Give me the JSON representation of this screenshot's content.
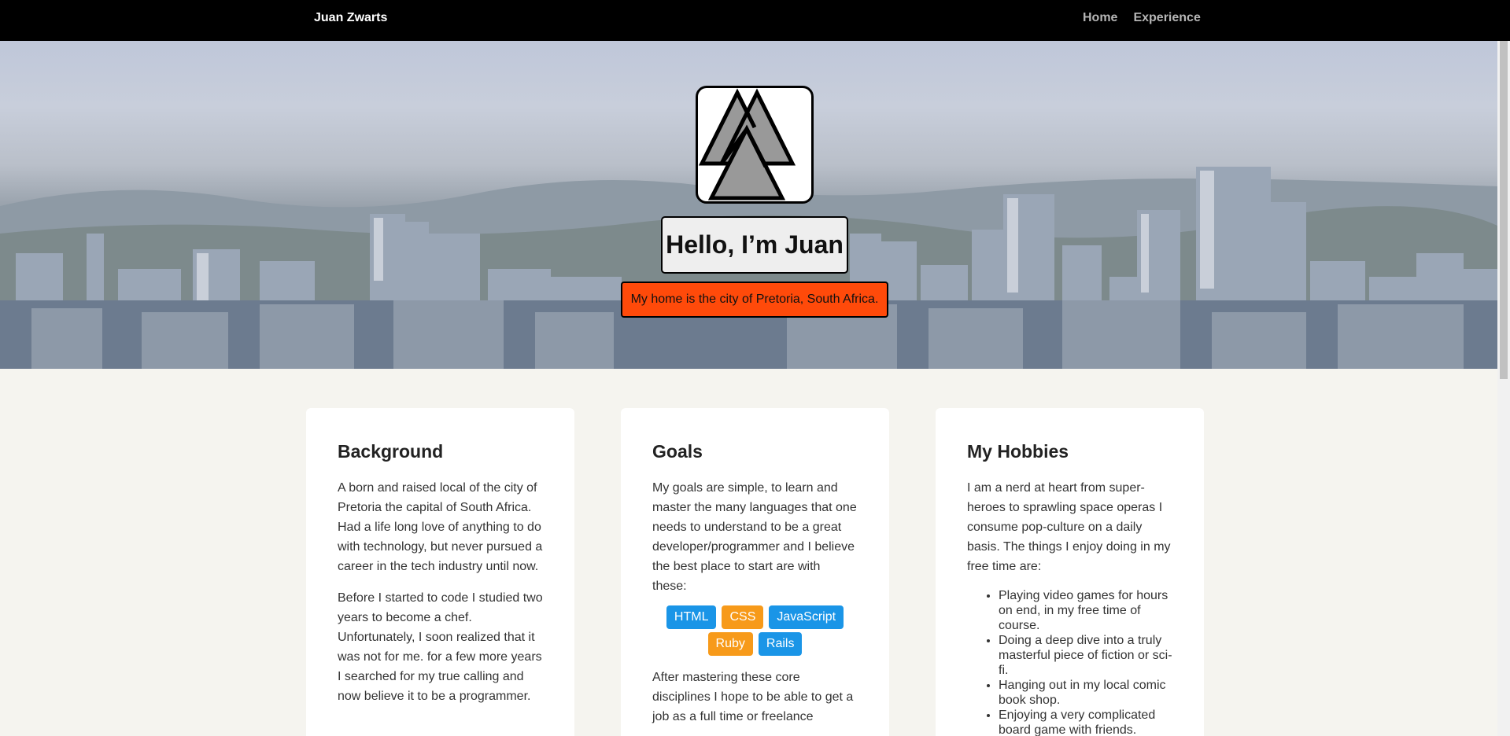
{
  "nav": {
    "brand": "Juan Zwarts",
    "links": [
      {
        "label": "Home"
      },
      {
        "label": "Experience"
      }
    ]
  },
  "hero": {
    "title": "Hello, I’m Juan",
    "tagline": "My home is the city of Pretoria, South Africa."
  },
  "cards": {
    "background": {
      "heading": "Background",
      "paragraphs": [
        "A born and raised local of the city of Pretoria the capital of South Africa. Had a life long love of anything to do with technology, but never pursued a career in the tech industry until now.",
        "Before I started to code I studied two years to become a chef. Unfortunately, I soon realized that it was not for me. for a few more years I searched for my true calling and now believe it to be a programmer."
      ]
    },
    "goals": {
      "heading": "Goals",
      "intro": "My goals are simple, to learn and master the many languages that one needs to understand to be a great developer/programmer and I believe the best place to start are with these:",
      "tags": [
        {
          "label": "HTML",
          "color": "#1a95e7"
        },
        {
          "label": "CSS",
          "color": "#f79a1a"
        },
        {
          "label": "JavaScript",
          "color": "#1a95e7"
        },
        {
          "label": "Ruby",
          "color": "#f79a1a"
        },
        {
          "label": "Rails",
          "color": "#1a95e7"
        }
      ],
      "outro": "After mastering these core disciplines I hope to be able to get a job as a full time or freelance"
    },
    "hobbies": {
      "heading": "My Hobbies",
      "intro": "I am a nerd at heart from super-heroes to sprawling space operas I consume pop-culture on a daily basis. The things I enjoy doing in my free time are:",
      "items": [
        "Playing video games for hours on end, in my free time of course.",
        "Doing a deep dive into a truly masterful piece of fiction or sci-fi.",
        "Hanging out in my local comic book shop.",
        "Enjoying a very complicated board game with friends."
      ]
    }
  },
  "colors": {
    "navbar": "#000000",
    "tagline_bg": "#ff4a0a",
    "tag_blue": "#1a95e7",
    "tag_orange": "#f79a1a",
    "page_bg": "#f5f4ef"
  },
  "icons": {
    "logo": "valknut-logo"
  }
}
